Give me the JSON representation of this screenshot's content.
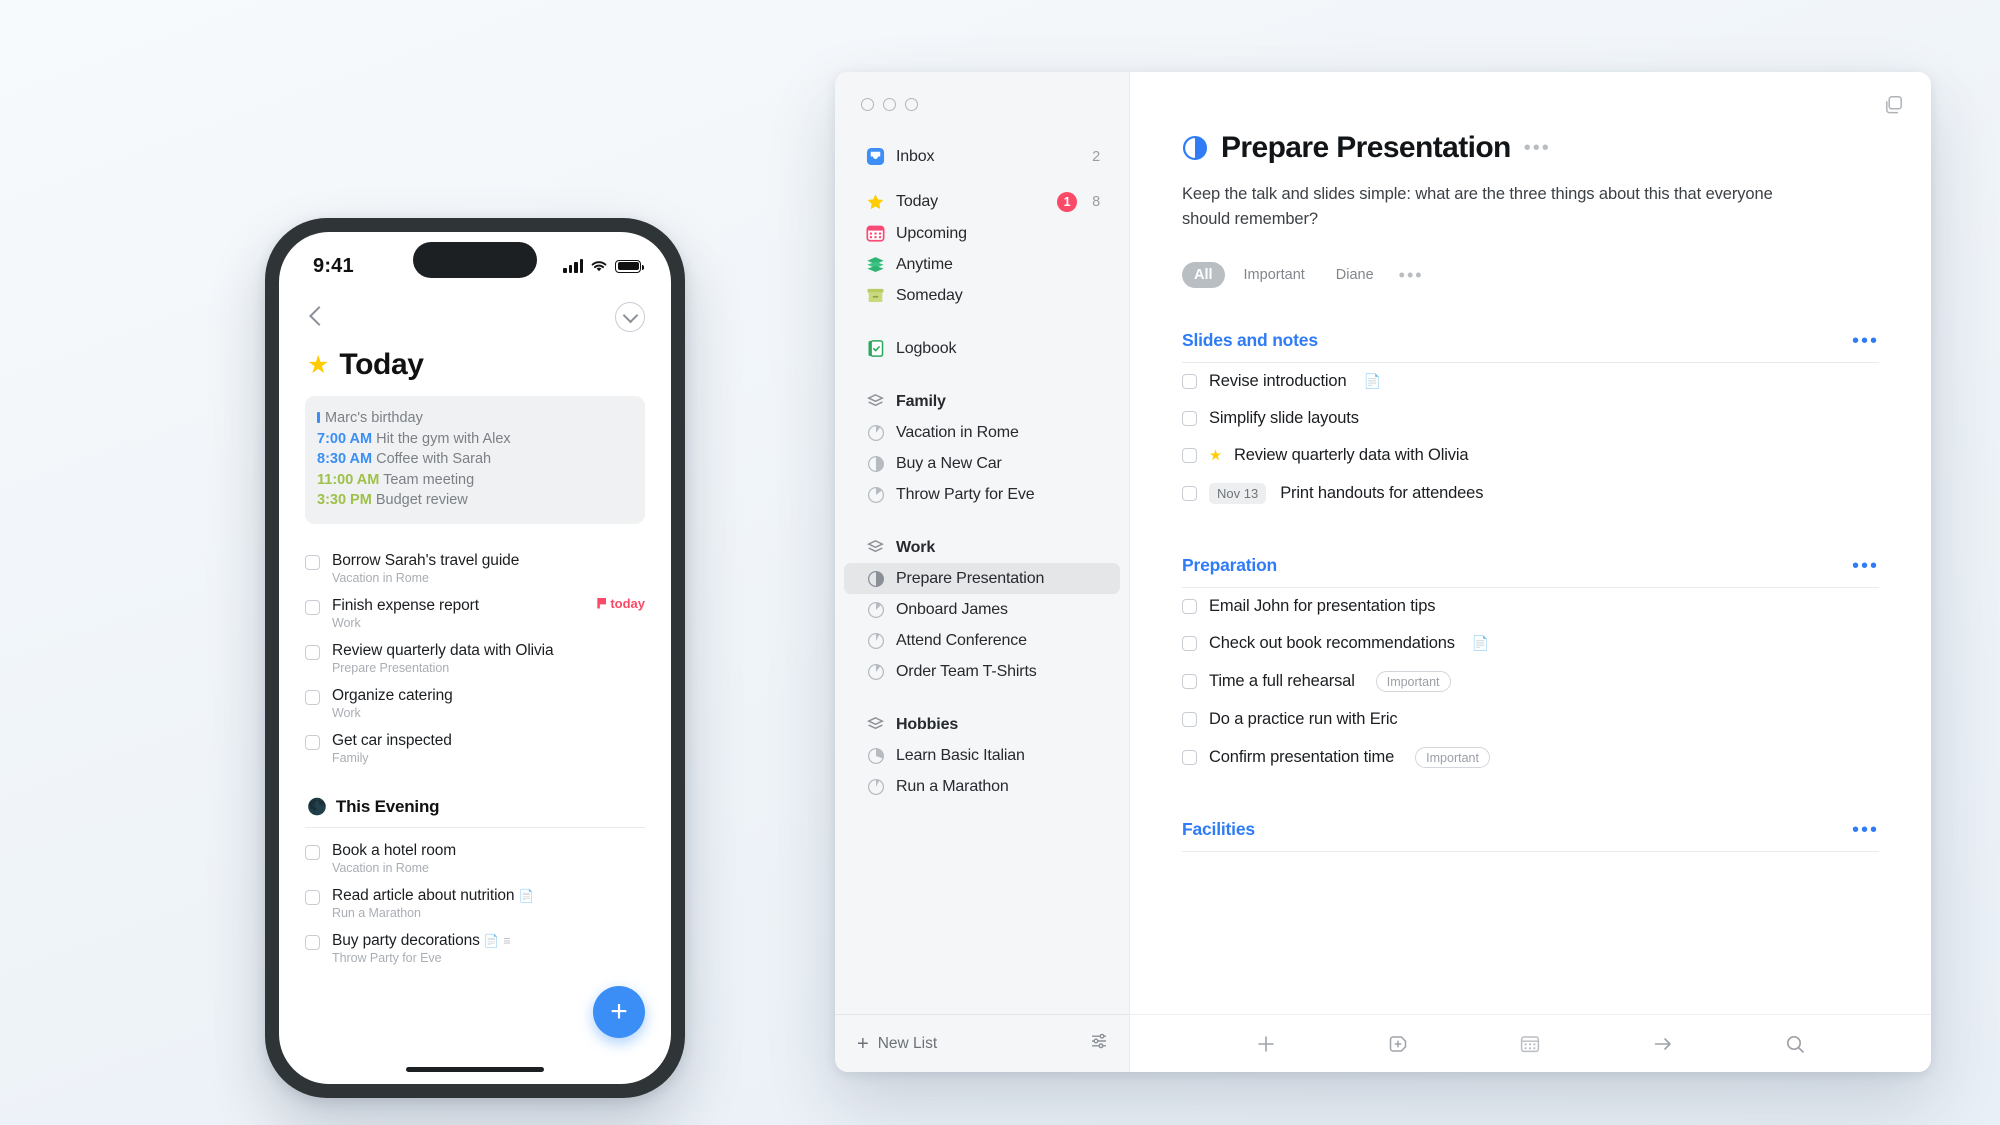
{
  "phone": {
    "status": {
      "time": "9:41",
      "signal_icon": "cellular-signal-icon",
      "wifi_icon": "wifi-icon",
      "battery_icon": "battery-icon"
    },
    "nav": {
      "back_icon": "back-chevron-icon",
      "collapse_icon": "chevron-down-circle-icon"
    },
    "header": {
      "title": "Today",
      "icon": "star-icon"
    },
    "calendar_card": {
      "events": [
        {
          "time": "",
          "label": "Marc's birthday",
          "style": "allday"
        },
        {
          "time": "7:00 AM",
          "label": "Hit the gym with Alex",
          "style": "blue"
        },
        {
          "time": "8:30 AM",
          "label": "Coffee with Sarah",
          "style": "blue"
        },
        {
          "time": "11:00 AM",
          "label": "Team meeting",
          "style": "green"
        },
        {
          "time": "3:30 PM",
          "label": "Budget review",
          "style": "green"
        }
      ]
    },
    "tasks": [
      {
        "title": "Borrow Sarah's travel guide",
        "sub": "Vacation in Rome",
        "flag": "",
        "icons": []
      },
      {
        "title": "Finish expense report",
        "sub": "Work",
        "flag": "today",
        "icons": []
      },
      {
        "title": "Review quarterly data with Olivia",
        "sub": "Prepare Presentation",
        "flag": "",
        "icons": []
      },
      {
        "title": "Organize catering",
        "sub": "Work",
        "flag": "",
        "icons": []
      },
      {
        "title": "Get car inspected",
        "sub": "Family",
        "flag": "",
        "icons": []
      }
    ],
    "evening": {
      "title": "This Evening",
      "icon": "moon-icon"
    },
    "evening_tasks": [
      {
        "title": "Book a hotel room",
        "sub": "Vacation in Rome",
        "icons": []
      },
      {
        "title": "Read article about nutrition",
        "sub": "Run a Marathon",
        "icons": [
          "note-icon"
        ]
      },
      {
        "title": "Buy party decorations",
        "sub": "Throw Party for Eve",
        "icons": [
          "note-icon",
          "checklist-icon"
        ]
      }
    ],
    "fab": {
      "label": "+",
      "icon": "add-task-icon",
      "color": "#3a8ef6"
    }
  },
  "window": {
    "traffic_lights": [
      "close",
      "minimize",
      "zoom"
    ],
    "top_right_icon": "duplicate-window-icon",
    "sidebar": {
      "smart_lists": [
        {
          "label": "Inbox",
          "icon": "inbox-icon",
          "count": "2",
          "badge": "",
          "selected": false
        },
        {
          "label": "Today",
          "icon": "star-icon",
          "count": "8",
          "badge": "1",
          "selected": false
        },
        {
          "label": "Upcoming",
          "icon": "calendar-icon",
          "count": "",
          "badge": "",
          "selected": false
        },
        {
          "label": "Anytime",
          "icon": "layers-icon",
          "count": "",
          "badge": "",
          "selected": false
        },
        {
          "label": "Someday",
          "icon": "box-icon",
          "count": "",
          "badge": "",
          "selected": false
        }
      ],
      "logbook": {
        "label": "Logbook",
        "icon": "logbook-icon"
      },
      "areas": [
        {
          "name": "Family",
          "icon": "area-icon",
          "projects": [
            {
              "label": "Vacation in Rome",
              "icon": "project-progress-icon",
              "progress": 15,
              "selected": false
            },
            {
              "label": "Buy a New Car",
              "icon": "project-progress-icon",
              "progress": 50,
              "selected": false
            },
            {
              "label": "Throw Party for Eve",
              "icon": "project-progress-icon",
              "progress": 30,
              "selected": false
            }
          ]
        },
        {
          "name": "Work",
          "icon": "area-icon",
          "projects": [
            {
              "label": "Prepare Presentation",
              "icon": "project-progress-icon",
              "progress": 50,
              "selected": true
            },
            {
              "label": "Onboard James",
              "icon": "project-progress-icon",
              "progress": 25,
              "selected": false
            },
            {
              "label": "Attend Conference",
              "icon": "project-progress-icon",
              "progress": 12,
              "selected": false
            },
            {
              "label": "Order Team T-Shirts",
              "icon": "project-progress-icon",
              "progress": 20,
              "selected": false
            }
          ]
        },
        {
          "name": "Hobbies",
          "icon": "area-icon",
          "projects": [
            {
              "label": "Learn Basic Italian",
              "icon": "project-progress-icon",
              "progress": 40,
              "selected": false
            },
            {
              "label": "Run a Marathon",
              "icon": "project-progress-icon",
              "progress": 12,
              "selected": false
            }
          ]
        }
      ],
      "footer": {
        "new_list_label": "New List",
        "new_list_icon": "plus-icon",
        "settings_icon": "sliders-icon"
      }
    },
    "project": {
      "title": "Prepare Presentation",
      "icon": "project-progress-icon",
      "title_dots": "•••",
      "description": "Keep the talk and slides simple: what are the three things about this that everyone should remember?",
      "filters": [
        {
          "label": "All",
          "active": true
        },
        {
          "label": "Important",
          "active": false
        },
        {
          "label": "Diane",
          "active": false
        }
      ],
      "filter_more": "•••",
      "sections": [
        {
          "title": "Slides and notes",
          "more": "•••",
          "tasks": [
            {
              "title": "Revise introduction",
              "star": false,
              "date": "",
              "tag": "",
              "icons": [
                "note-icon"
              ]
            },
            {
              "title": "Simplify slide layouts",
              "star": false,
              "date": "",
              "tag": "",
              "icons": []
            },
            {
              "title": "Review quarterly data with Olivia",
              "star": true,
              "date": "",
              "tag": "",
              "icons": []
            },
            {
              "title": "Print handouts for attendees",
              "star": false,
              "date": "Nov 13",
              "tag": "",
              "icons": []
            }
          ]
        },
        {
          "title": "Preparation",
          "more": "•••",
          "tasks": [
            {
              "title": "Email John for presentation tips",
              "star": false,
              "date": "",
              "tag": "",
              "icons": []
            },
            {
              "title": "Check out book recommendations",
              "star": false,
              "date": "",
              "tag": "",
              "icons": [
                "note-icon"
              ]
            },
            {
              "title": "Time a full rehearsal",
              "star": false,
              "date": "",
              "tag": "Important",
              "icons": []
            },
            {
              "title": "Do a practice run with Eric",
              "star": false,
              "date": "",
              "tag": "",
              "icons": []
            },
            {
              "title": "Confirm presentation time",
              "star": false,
              "date": "",
              "tag": "Important",
              "icons": []
            }
          ]
        },
        {
          "title": "Facilities",
          "more": "•••",
          "tasks": []
        }
      ]
    },
    "toolbar": [
      {
        "icon": "new-todo-icon",
        "label": "+"
      },
      {
        "icon": "new-heading-icon",
        "label": ""
      },
      {
        "icon": "calendar-icon",
        "label": ""
      },
      {
        "icon": "move-icon",
        "label": ""
      },
      {
        "icon": "search-icon",
        "label": ""
      }
    ]
  },
  "colors": {
    "accent_blue": "#2f7cf6",
    "star_yellow": "#FFCC00",
    "badge_red": "#fa4a67",
    "sidebar_bg": "#f5f6f7"
  }
}
